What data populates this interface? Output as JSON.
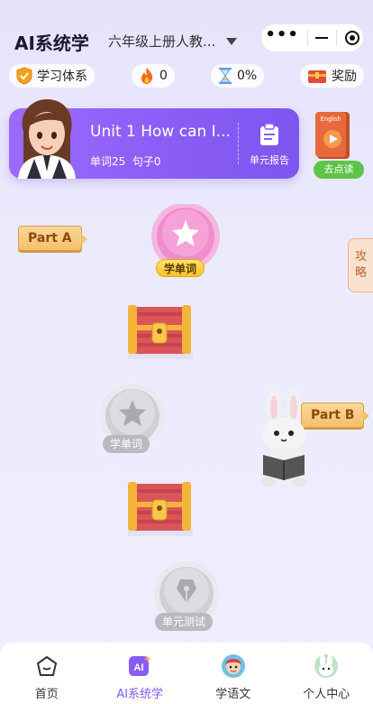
{
  "header": {
    "title": "AI系统学",
    "grade": "六年级上册人教..."
  },
  "stats": {
    "system_label": "学习体系",
    "fire_count": "0",
    "progress": "0%",
    "reward_label": "奖励"
  },
  "banner": {
    "unit_title": "Unit 1 How can I...",
    "words_label": "单词25",
    "sentences_label": "句子0",
    "report_label": "单元报告"
  },
  "book": {
    "cover_text": "English",
    "read_label": "去点读"
  },
  "side": {
    "strategy_char1": "攻",
    "strategy_char2": "略"
  },
  "path": {
    "part_a": "Part A",
    "part_b": "Part B",
    "node1_label": "学单词",
    "node2_label": "学单词",
    "node3_label": "单元测试"
  },
  "tabbar": {
    "home": "首页",
    "ai": "AI系统学",
    "chinese": "学语文",
    "profile": "个人中心",
    "ai_icon_text": "AI"
  },
  "colors": {
    "accent": "#7a5cf0",
    "banner": "#8a5cf6",
    "active_node": "#f08ccf",
    "read_btn": "#5ec447"
  }
}
